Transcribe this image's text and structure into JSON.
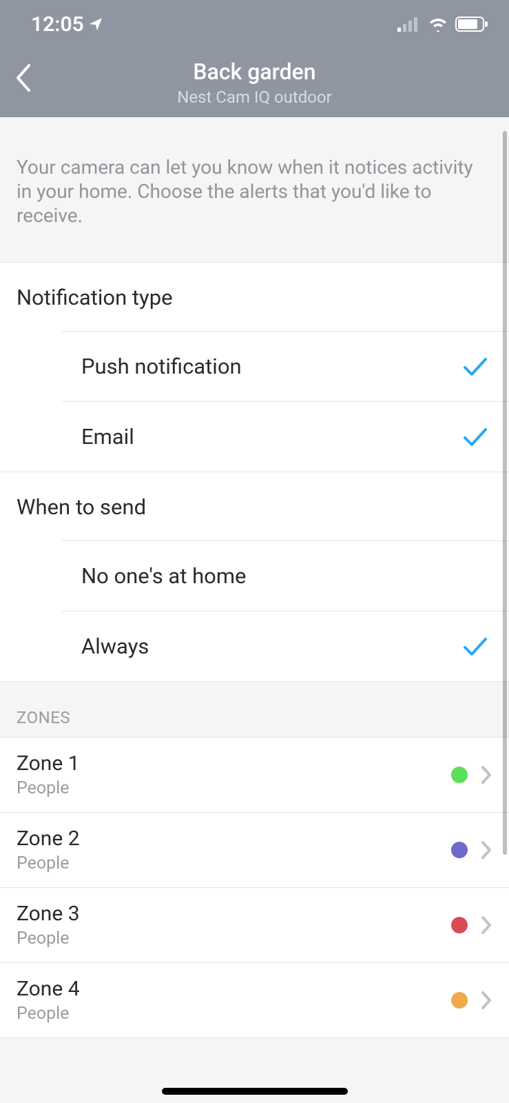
{
  "status": {
    "time": "12:05"
  },
  "header": {
    "title": "Back garden",
    "subtitle": "Nest Cam IQ outdoor"
  },
  "intro": "Your camera can let you know when it notices activity in your home. Choose the alerts that you'd like to receive.",
  "sections": {
    "notification_type": {
      "title": "Notification type",
      "options": [
        {
          "label": "Push notification",
          "checked": true
        },
        {
          "label": "Email",
          "checked": true
        }
      ]
    },
    "when_to_send": {
      "title": "When to send",
      "options": [
        {
          "label": "No one's at home",
          "checked": false
        },
        {
          "label": "Always",
          "checked": true
        }
      ]
    }
  },
  "zones": {
    "header": "ZONES",
    "items": [
      {
        "name": "Zone 1",
        "sub": "People",
        "color": "#5adf5a"
      },
      {
        "name": "Zone 2",
        "sub": "People",
        "color": "#6d6bc9"
      },
      {
        "name": "Zone 3",
        "sub": "People",
        "color": "#d94a57"
      },
      {
        "name": "Zone 4",
        "sub": "People",
        "color": "#f0a94f"
      }
    ]
  }
}
